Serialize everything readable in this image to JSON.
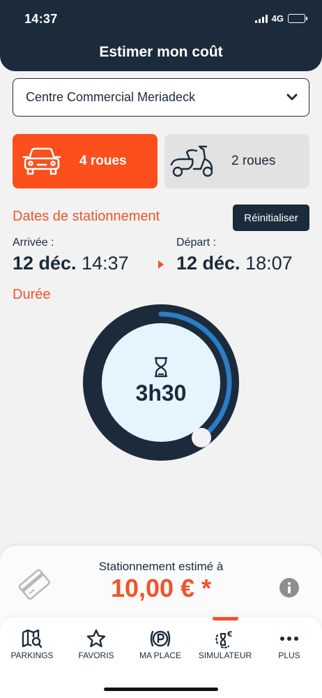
{
  "status_bar": {
    "time": "14:37",
    "network": "4G"
  },
  "header": {
    "title": "Estimer mon coût"
  },
  "location_select": {
    "value": "Centre Commercial Meriadeck",
    "icon": "chevron-down-icon"
  },
  "vehicle_types": [
    {
      "label": "4 roues",
      "icon": "car-icon",
      "selected": true
    },
    {
      "label": "2 roues",
      "icon": "scooter-icon",
      "selected": false
    }
  ],
  "dates": {
    "section_title": "Dates de stationnement",
    "reset_label": "Réinitialiser",
    "arrival_label": "Arrivée :",
    "arrival_date": "12 déc.",
    "arrival_time": "14:37",
    "departure_label": "Départ :",
    "departure_date": "12 déc.",
    "departure_time": "18:07"
  },
  "duration": {
    "section_title": "Durée",
    "value": "3h30",
    "dial_fraction": 0.4
  },
  "estimate": {
    "label": "Stationnement estimé à",
    "price": "10,00 € *"
  },
  "tabs": [
    {
      "label": "PARKINGS",
      "icon": "map-search-icon"
    },
    {
      "label": "FAVORIS",
      "icon": "star-icon"
    },
    {
      "label": "MA PLACE",
      "icon": "parking-icon"
    },
    {
      "label": "SIMULATEUR",
      "icon": "hourglass-euro-icon",
      "active": true
    },
    {
      "label": "PLUS",
      "icon": "more-icon"
    }
  ],
  "colors": {
    "header": "#1c2b3b",
    "accent": "#fc4f1b",
    "dial_ring": "#1c2b3b",
    "dial_progress": "#2a7ec7",
    "dial_center": "#e6f4fd"
  }
}
